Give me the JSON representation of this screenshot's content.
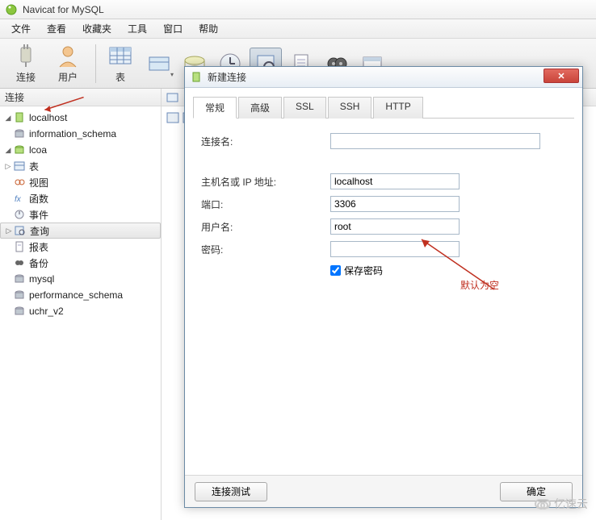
{
  "app": {
    "title": "Navicat for MySQL"
  },
  "menu": {
    "file": "文件",
    "view": "查看",
    "fav": "收藏夹",
    "tools": "工具",
    "window": "窗口",
    "help": "帮助"
  },
  "toolbar": {
    "connect": "连接",
    "user": "用户",
    "table": "表"
  },
  "sidebar": {
    "header": "连接",
    "localhost": "localhost",
    "info_schema": "information_schema",
    "lcoa": "lcoa",
    "tables": "表",
    "views": "视图",
    "functions": "函数",
    "events": "事件",
    "queries": "查询",
    "reports": "报表",
    "backups": "备份",
    "mysql": "mysql",
    "perf_schema": "performance_schema",
    "uchr": "uchr_v2"
  },
  "dialog": {
    "title": "新建连接",
    "tabs": {
      "general": "常规",
      "advanced": "高级",
      "ssl": "SSL",
      "ssh": "SSH",
      "http": "HTTP"
    },
    "labels": {
      "conn_name": "连接名:",
      "host": "主机名或 IP 地址:",
      "port": "端口:",
      "user": "用户名:",
      "pass": "密码:",
      "save_pass": "保存密码"
    },
    "values": {
      "conn_name": "",
      "host": "localhost",
      "port": "3306",
      "user": "root",
      "pass": ""
    },
    "buttons": {
      "test": "连接测试",
      "ok": "确定"
    }
  },
  "annotation": {
    "default_empty": "默认为空"
  },
  "watermark": "亿速云"
}
